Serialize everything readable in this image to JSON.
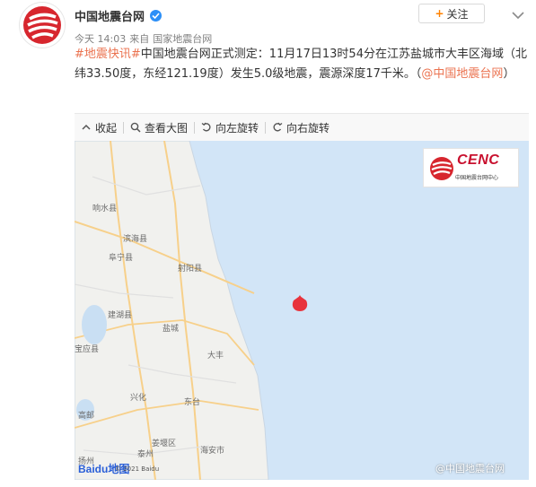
{
  "account": {
    "name": "中国地震台网",
    "time": "今天 14:03",
    "source_prefix": "来自",
    "source": "国家地震台网"
  },
  "follow_button": {
    "plus": "+",
    "label": "关注"
  },
  "post": {
    "hashtag": "#地震快讯#",
    "body": "中国地震台网正式测定：11月17日13时54分在江苏盐城市大丰区海域（北纬33.50度，东经121.19度）发生5.0级地震，震源深度17千米。（",
    "mention": "@中国地震台网",
    "tail": "）"
  },
  "toolbar": {
    "collapse": "收起",
    "view_large": "查看大图",
    "rotate_left": "向左旋转",
    "rotate_right": "向右旋转"
  },
  "map": {
    "logo_word": "CENC",
    "logo_sub": "中国地震台网中心",
    "places": {
      "xiangshui": "响水县",
      "binhai": "滨海县",
      "funing": "阜宁县",
      "sheyang": "射阳县",
      "baoying": "宝应县",
      "jianhu": "建湖县",
      "yancheng": "盐城",
      "dafeng": "大丰",
      "gaoyou": "高邮",
      "xinghua": "兴化",
      "dongtai": "东台",
      "taizhou": "泰州",
      "jiangyan": "姜堰区",
      "hai_an": "海安市",
      "yangzhou": "扬州"
    },
    "baidu": "Baidu地图",
    "copyright": "© 2021 Baidu",
    "watermark": "@中国地震台网"
  },
  "colors": {
    "sea": "#d2e5f7",
    "land": "#f1f1ee",
    "hashtag": "#eb7350",
    "epicenter": "#e8333c",
    "verified": "#2c8ff7"
  },
  "icons": [
    "cenc-avatar-icon",
    "verified-icon",
    "chevron-down-icon",
    "collapse-icon",
    "magnify-icon",
    "rotate-left-icon",
    "rotate-right-icon",
    "epicenter-pin-icon"
  ]
}
